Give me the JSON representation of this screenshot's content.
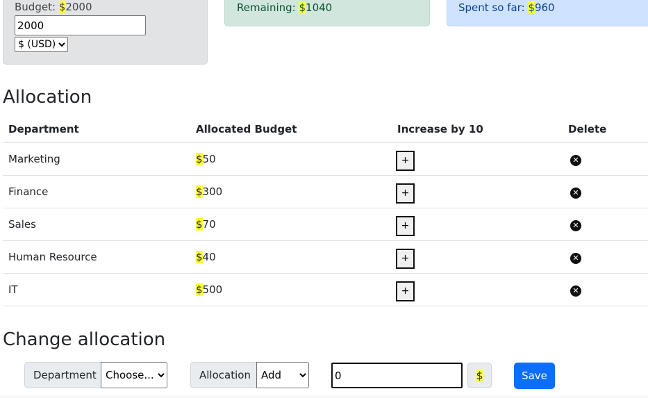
{
  "summary": {
    "budget_label": "Budget: ",
    "budget_currency": "$",
    "budget_value": "2000",
    "budget_input_value": "2000",
    "currency_option": "$ (USD)",
    "remaining_label": "Remaining: ",
    "remaining_currency": "$",
    "remaining_value": "1040",
    "spent_label": "Spent so far: ",
    "spent_currency": "$",
    "spent_value": "960"
  },
  "allocation": {
    "title": "Allocation",
    "headers": {
      "department": "Department",
      "allocated_budget": "Allocated Budget",
      "increase": "Increase by 10",
      "delete": "Delete"
    },
    "plus_label": "+",
    "delete_glyph": "✕",
    "rows": [
      {
        "department": "Marketing",
        "currency": "$",
        "value": "50"
      },
      {
        "department": "Finance",
        "currency": "$",
        "value": "300"
      },
      {
        "department": "Sales",
        "currency": "$",
        "value": "70"
      },
      {
        "department": "Human Resource",
        "currency": "$",
        "value": "40"
      },
      {
        "department": "IT",
        "currency": "$",
        "value": "500"
      }
    ]
  },
  "change": {
    "title": "Change allocation",
    "department_label": "Department",
    "department_selected": "Choose...",
    "allocation_label": "Allocation",
    "allocation_selected": "Add",
    "amount_value": "0",
    "currency": "$",
    "save_label": "Save"
  },
  "colors": {
    "highlight": "#ffff3a",
    "save_button": "#0d6efd",
    "remaining_bg": "#d1e7dd",
    "spent_bg": "#cfe2ff",
    "budget_bg": "#e2e3e5"
  }
}
